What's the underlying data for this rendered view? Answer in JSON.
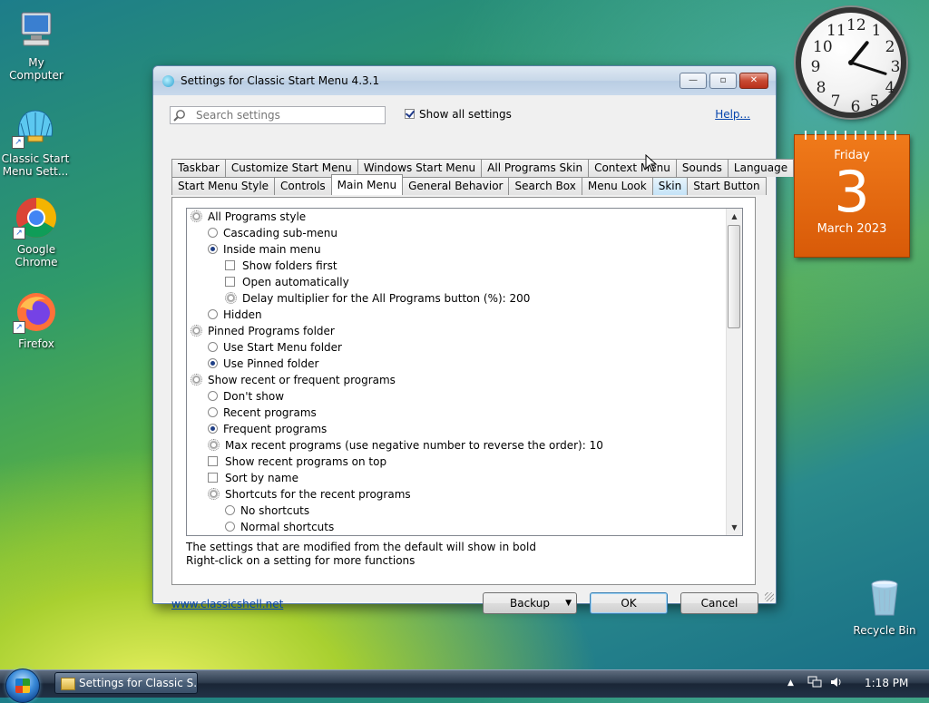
{
  "desktop": {
    "icons": [
      {
        "label": "My Computer"
      },
      {
        "label": "Classic Start Menu Sett..."
      },
      {
        "label": "Google Chrome"
      },
      {
        "label": "Firefox"
      },
      {
        "label": "Recycle Bin"
      }
    ],
    "clock": {
      "numbers": [
        "12",
        "1",
        "2",
        "3",
        "4",
        "5",
        "6",
        "7",
        "8",
        "9",
        "10",
        "11"
      ],
      "time": "1:18"
    },
    "calendar": {
      "weekday": "Friday",
      "day": "3",
      "month_year": "March 2023"
    }
  },
  "window": {
    "title": "Settings for Classic Start Menu 4.3.1",
    "search_placeholder": "Search settings",
    "show_all_label": "Show all settings",
    "show_all_checked": true,
    "help_label": "Help...",
    "tabs_row1": [
      "Taskbar",
      "Customize Start Menu",
      "Windows Start Menu",
      "All Programs Skin",
      "Context Menu",
      "Sounds",
      "Language"
    ],
    "tabs_row2": [
      "Start Menu Style",
      "Controls",
      "Main Menu",
      "General Behavior",
      "Search Box",
      "Menu Look",
      "Skin",
      "Start Button"
    ],
    "active_tab": "Main Menu",
    "settings": [
      {
        "label": "All Programs style",
        "kind": "group",
        "level": 0
      },
      {
        "label": "Cascading sub-menu",
        "kind": "radio",
        "level": 1,
        "checked": false
      },
      {
        "label": "Inside main menu",
        "kind": "radio",
        "level": 1,
        "checked": true
      },
      {
        "label": "Show folders first",
        "kind": "check",
        "level": 2,
        "checked": false
      },
      {
        "label": "Open automatically",
        "kind": "check",
        "level": 2,
        "checked": false
      },
      {
        "label": "Delay multiplier for the All Programs button (%): 200",
        "kind": "value",
        "level": 2
      },
      {
        "label": "Hidden",
        "kind": "radio",
        "level": 1,
        "checked": false
      },
      {
        "label": "Pinned Programs folder",
        "kind": "group",
        "level": 0
      },
      {
        "label": "Use Start Menu folder",
        "kind": "radio",
        "level": 1,
        "checked": false
      },
      {
        "label": "Use Pinned folder",
        "kind": "radio",
        "level": 1,
        "checked": true
      },
      {
        "label": "Show recent or frequent programs",
        "kind": "group",
        "level": 0
      },
      {
        "label": "Don't show",
        "kind": "radio",
        "level": 1,
        "checked": false
      },
      {
        "label": "Recent programs",
        "kind": "radio",
        "level": 1,
        "checked": false
      },
      {
        "label": "Frequent programs",
        "kind": "radio",
        "level": 1,
        "checked": true
      },
      {
        "label": "Max recent programs (use negative number to reverse the order): 10",
        "kind": "value",
        "level": 1
      },
      {
        "label": "Show recent programs on top",
        "kind": "check",
        "level": 1,
        "checked": false
      },
      {
        "label": "Sort by name",
        "kind": "check",
        "level": 1,
        "checked": false
      },
      {
        "label": "Shortcuts for the recent programs",
        "kind": "value",
        "level": 1
      },
      {
        "label": "No shortcuts",
        "kind": "radio",
        "level": 2,
        "checked": false
      },
      {
        "label": "Normal shortcuts",
        "kind": "radio",
        "level": 2,
        "checked": false
      }
    ],
    "info_line1": "The settings that are modified from the default will show in bold",
    "info_line2": "Right-click on a setting for more functions",
    "website_link": "www.classicshell.net",
    "backup_label": "Backup",
    "ok_label": "OK",
    "cancel_label": "Cancel"
  },
  "taskbar": {
    "task_label": "Settings for Classic S...",
    "time": "1:18 PM"
  }
}
